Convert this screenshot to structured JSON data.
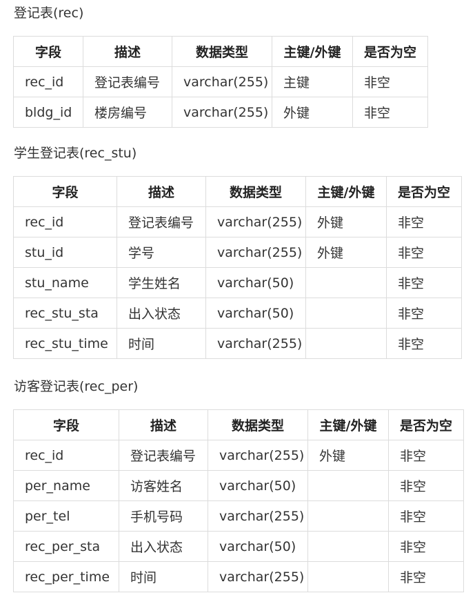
{
  "headers": [
    "字段",
    "描述",
    "数据类型",
    "主键/外键",
    "是否为空"
  ],
  "tables": [
    {
      "title": "登记表(rec)",
      "rows": [
        [
          "rec_id",
          "登记表编号",
          "varchar(255)",
          "主键",
          "非空"
        ],
        [
          "bldg_id",
          "楼房编号",
          "varchar(255)",
          "外键",
          "非空"
        ]
      ]
    },
    {
      "title": "学生登记表(rec_stu)",
      "rows": [
        [
          "rec_id",
          "登记表编号",
          "varchar(255)",
          "外键",
          "非空"
        ],
        [
          "stu_id",
          "学号",
          "varchar(255)",
          "外键",
          "非空"
        ],
        [
          "stu_name",
          "学生姓名",
          "varchar(50)",
          "",
          "非空"
        ],
        [
          "rec_stu_sta",
          "出入状态",
          "varchar(50)",
          "",
          "非空"
        ],
        [
          "rec_stu_time",
          "时间",
          "varchar(255)",
          "",
          "非空"
        ]
      ]
    },
    {
      "title": "访客登记表(rec_per)",
      "rows": [
        [
          "rec_id",
          "登记表编号",
          "varchar(255)",
          "外键",
          "非空"
        ],
        [
          "per_name",
          "访客姓名",
          "varchar(50)",
          "",
          "非空"
        ],
        [
          "per_tel",
          "手机号码",
          "varchar(255)",
          "",
          "非空"
        ],
        [
          "rec_per_sta",
          "出入状态",
          "varchar(50)",
          "",
          "非空"
        ],
        [
          "rec_per_time",
          "时间",
          "varchar(255)",
          "",
          "非空"
        ]
      ]
    }
  ]
}
